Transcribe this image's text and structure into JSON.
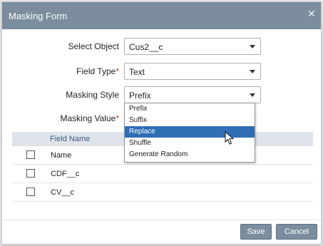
{
  "header": {
    "title": "Masking Form"
  },
  "form": {
    "select_object": {
      "label": "Select Object",
      "value": "Cus2__c"
    },
    "field_type": {
      "label": "Field Type",
      "required_mark": "*",
      "value": "Text"
    },
    "masking_style": {
      "label": "Masking Style",
      "value": "Prefix"
    },
    "masking_value": {
      "label": "Masking Value",
      "required_mark": "*"
    }
  },
  "dropdown": {
    "options": [
      "Prefix",
      "Suffix",
      "Replace",
      "Shuffle",
      "Generate Random"
    ],
    "highlighted": "Replace"
  },
  "table": {
    "header": "Field Name",
    "rows": [
      {
        "name": "Name"
      },
      {
        "name": "CDF__c"
      },
      {
        "name": "CV__c"
      }
    ]
  },
  "footer": {
    "save": "Save",
    "cancel": "Cancel"
  },
  "colors": {
    "header_bg": "#7b8d9e",
    "highlight": "#2f6db5",
    "required": "#c0392b"
  }
}
